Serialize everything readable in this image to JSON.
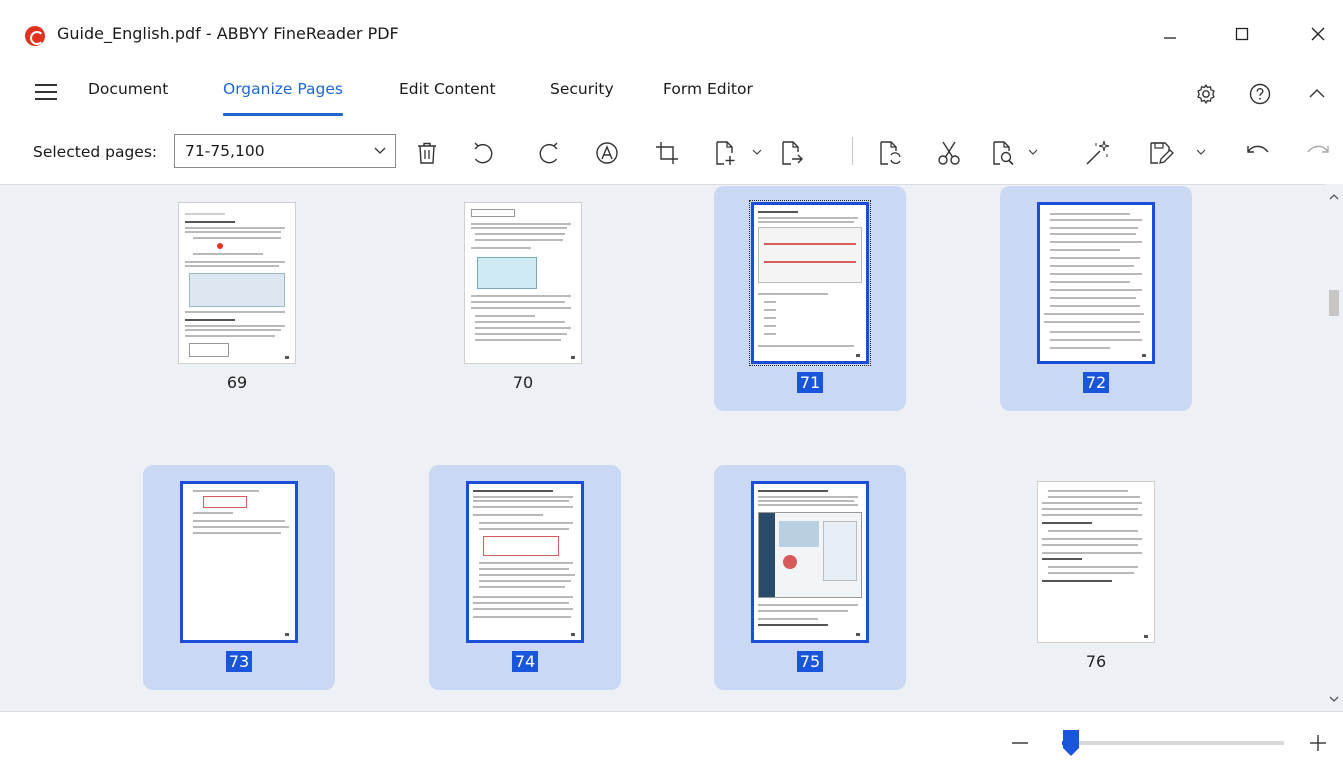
{
  "window": {
    "title": "Guide_English.pdf - ABBYY FineReader PDF",
    "controls": [
      "minimize",
      "maximize",
      "close"
    ]
  },
  "menu": {
    "tabs": [
      {
        "label": "Document",
        "active": false
      },
      {
        "label": "Organize Pages",
        "active": true
      },
      {
        "label": "Edit Content",
        "active": false
      },
      {
        "label": "Security",
        "active": false
      },
      {
        "label": "Form Editor",
        "active": false
      }
    ],
    "right_icons": [
      "gear-icon",
      "help-icon",
      "collapse-ribbon-icon"
    ]
  },
  "toolbar": {
    "selected_pages_label": "Selected pages:",
    "selected_pages_value": "71-75,100",
    "tools": [
      "delete-page-icon",
      "rotate-left-icon",
      "rotate-right-icon",
      "auto-orient-icon",
      "crop-icon",
      "add-page-icon",
      "extract-page-icon",
      "replace-page-icon",
      "split-icon",
      "recognize-icon",
      "enhance-icon",
      "save-pages-icon",
      "undo-icon",
      "redo-icon"
    ]
  },
  "pages": [
    {
      "number": "69",
      "selected": false,
      "focused": false
    },
    {
      "number": "70",
      "selected": false,
      "focused": false
    },
    {
      "number": "71",
      "selected": true,
      "focused": true
    },
    {
      "number": "72",
      "selected": true,
      "focused": false
    },
    {
      "number": "73",
      "selected": true,
      "focused": false
    },
    {
      "number": "74",
      "selected": true,
      "focused": false
    },
    {
      "number": "75",
      "selected": true,
      "focused": false
    },
    {
      "number": "76",
      "selected": false,
      "focused": false
    }
  ],
  "zoom": {
    "level_fraction": 0.04
  },
  "colors": {
    "accent": "#1f66d1",
    "selection_bg": "#cad8f3",
    "selection_border": "#1a4ed8",
    "brand_red": "#e0301e",
    "canvas_bg": "#edf0f4"
  }
}
